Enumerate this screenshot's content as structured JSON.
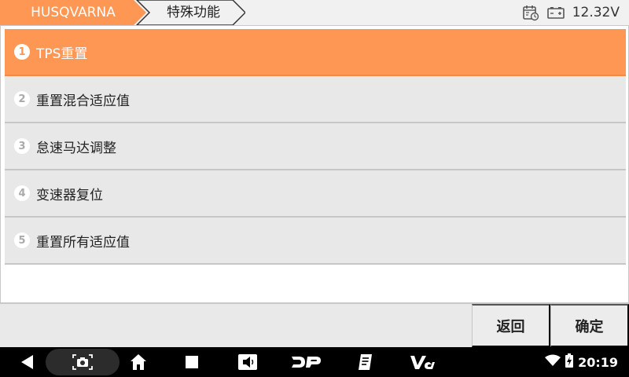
{
  "header": {
    "brand": "HUSQVARNA",
    "function_title": "特殊功能",
    "voltage": "12.32V",
    "brand_color": "#ff9754"
  },
  "menu": {
    "items": [
      {
        "num": "1",
        "label": "TPS重置"
      },
      {
        "num": "2",
        "label": "重置混合适应值"
      },
      {
        "num": "3",
        "label": "怠速马达调整"
      },
      {
        "num": "4",
        "label": "变速器复位"
      },
      {
        "num": "5",
        "label": "重置所有适应值"
      }
    ],
    "selected_index": 0
  },
  "actions": {
    "back_label": "返回",
    "ok_label": "确定"
  },
  "system": {
    "time": "20:19"
  },
  "icons": [
    "calendar-clock-icon",
    "battery-icon",
    "back-icon",
    "screenshot-icon",
    "home-icon",
    "recents-icon",
    "volume-icon",
    "dp-logo-icon",
    "report-icon",
    "vci-icon",
    "wifi-icon",
    "battery-charging-icon"
  ]
}
